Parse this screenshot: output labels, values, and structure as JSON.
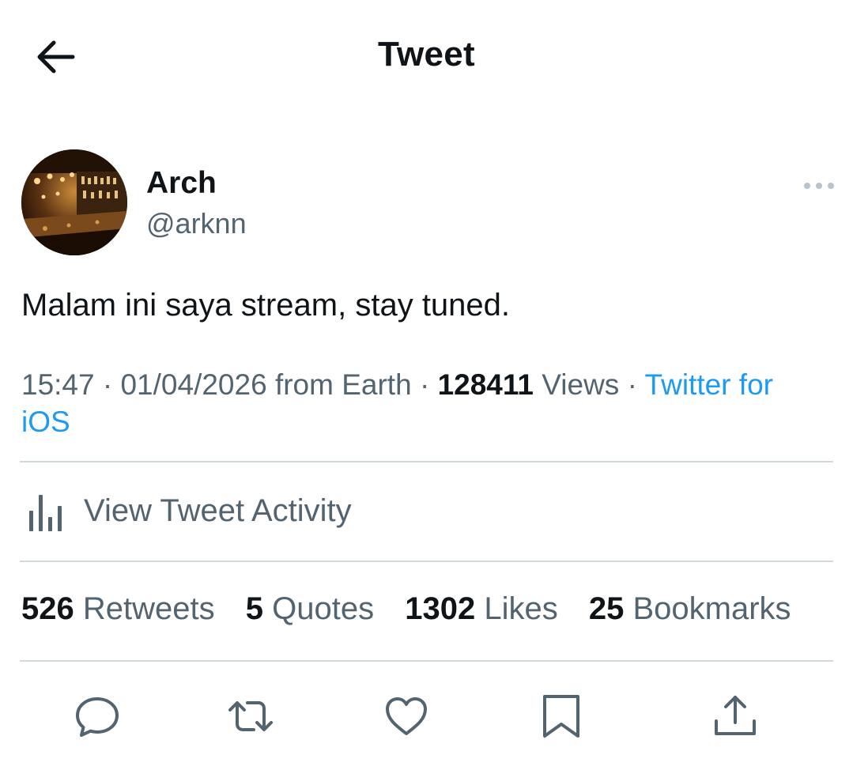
{
  "header": {
    "title": "Tweet",
    "back_icon": "arrow-left-icon"
  },
  "tweet": {
    "author": {
      "name": "Arch",
      "handle": "@arknn",
      "avatar_icon": "bar-interior-photo"
    },
    "more_icon": "more-horizontal-icon",
    "text": "Malam ini saya stream, stay tuned.",
    "meta": {
      "time": "15:47",
      "separator": "·",
      "date": "01/04/2026",
      "from_text": "from Earth",
      "views_count": "128411",
      "views_label": "Views",
      "source": "Twitter for iOS"
    },
    "activity": {
      "label": "View Tweet Activity",
      "icon": "bar-chart-icon"
    },
    "stats": {
      "retweets_count": "526",
      "retweets_label": "Retweets",
      "quotes_count": "5",
      "quotes_label": "Quotes",
      "likes_count": "1302",
      "likes_label": "Likes",
      "bookmarks_count": "25",
      "bookmarks_label": "Bookmarks"
    },
    "actions": [
      "reply-icon",
      "retweet-icon",
      "like-icon",
      "bookmark-icon",
      "share-icon"
    ]
  },
  "colors": {
    "text_primary": "#0f1419",
    "text_secondary": "#536471",
    "link": "#1d9bf0",
    "divider": "#cfd9de",
    "background": "#ffffff"
  }
}
